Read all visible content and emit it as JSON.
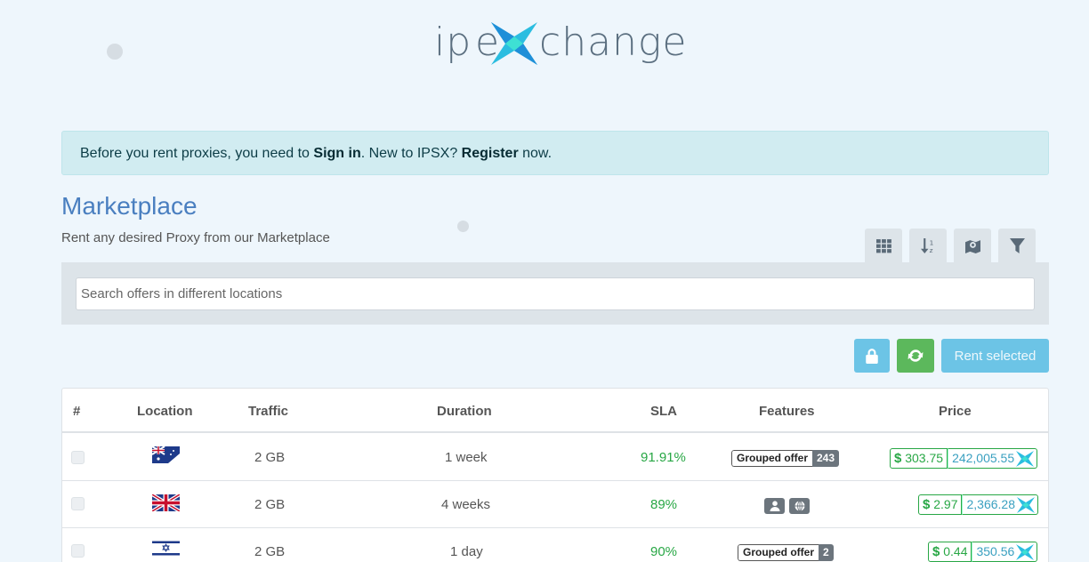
{
  "logo": {
    "text_ip": "ip",
    "text_e": "e",
    "text_rest": "change"
  },
  "alert": {
    "prefix": "Before you rent proxies, you need to ",
    "sign_in": "Sign in",
    "middle": ". New to IPSX? ",
    "register": "Register",
    "suffix": " now."
  },
  "page": {
    "title": "Marketplace",
    "subtitle": "Rent any desired Proxy from our Marketplace"
  },
  "view_tabs": [
    {
      "icon": "grid-icon"
    },
    {
      "icon": "sort-icon"
    },
    {
      "icon": "map-icon"
    },
    {
      "icon": "filter-icon"
    }
  ],
  "search": {
    "placeholder": "Search offers in different locations",
    "value": ""
  },
  "actions": {
    "rent_selected_label": "Rent selected"
  },
  "table": {
    "headers": {
      "num": "#",
      "location": "Location",
      "traffic": "Traffic",
      "duration": "Duration",
      "sla": "SLA",
      "features": "Features",
      "price": "Price"
    },
    "rows": [
      {
        "flag": "australia",
        "traffic": "2 GB",
        "duration": "1 week",
        "sla": "91.91%",
        "feature_label": "Grouped offer",
        "feature_count": "243",
        "usd": "303.75",
        "ipx": "242,005.55"
      },
      {
        "flag": "united-kingdom",
        "traffic": "2 GB",
        "duration": "4 weeks",
        "sla": "89%",
        "feature_icons": [
          "user-icon",
          "globe-icon"
        ],
        "usd": "2.97",
        "ipx": "2,366.28"
      },
      {
        "flag": "israel",
        "traffic": "2 GB",
        "duration": "1 day",
        "sla": "90%",
        "feature_label": "Grouped offer",
        "feature_count": "2",
        "usd": "0.44",
        "ipx": "350.56"
      }
    ]
  },
  "colors": {
    "accent_blue": "#4a7fc0",
    "success_green": "#28a745",
    "info_blue": "#6cc4e6",
    "alert_bg": "#d1ecf1"
  }
}
